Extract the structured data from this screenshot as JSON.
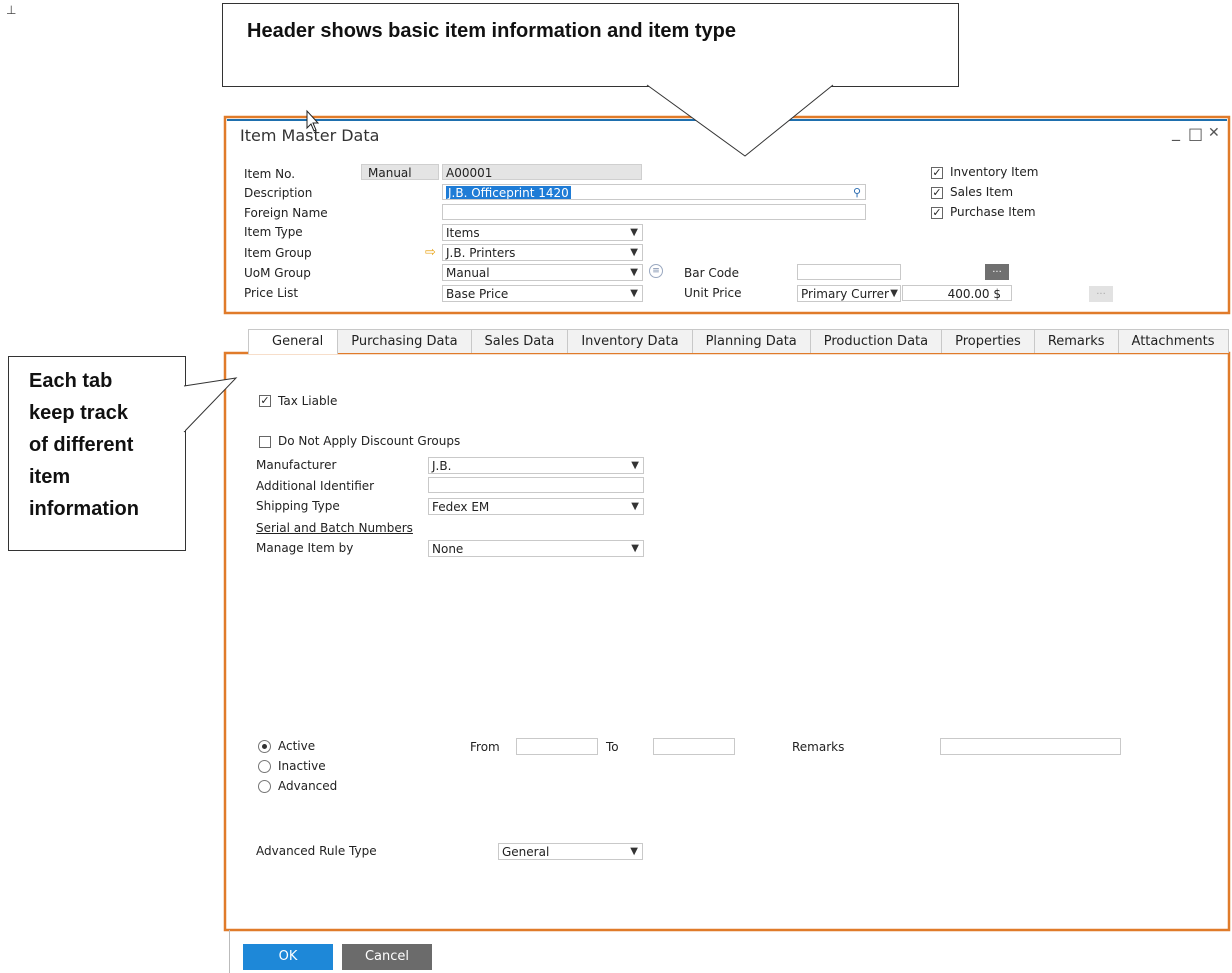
{
  "annotations": {
    "header_callout": "Header shows basic item information and item type",
    "tab_callout_lines": [
      "Each tab",
      "keep track",
      "of different",
      "item",
      "information"
    ]
  },
  "window": {
    "title": "Item Master Data",
    "controls": {
      "minimize": "_",
      "maximize": "□",
      "close": "✕"
    }
  },
  "header": {
    "item_no_label": "Item No.",
    "item_no_series": "Manual",
    "item_no_value": "A00001",
    "description_label": "Description",
    "description_value": "J.B. Officeprint 1420",
    "foreign_name_label": "Foreign Name",
    "foreign_name_value": "",
    "item_type_label": "Item Type",
    "item_type_value": "Items",
    "item_group_label": "Item Group",
    "item_group_value": "J.B. Printers",
    "uom_group_label": "UoM Group",
    "uom_group_value": "Manual",
    "price_list_label": "Price List",
    "price_list_value": "Base Price",
    "bar_code_label": "Bar Code",
    "bar_code_value": "",
    "unit_price_label": "Unit Price",
    "currency_value": "Primary Currer",
    "unit_price_value": "400.00 $",
    "dots_label": "...",
    "checkboxes": {
      "inventory_item": {
        "label": "Inventory Item",
        "checked": true
      },
      "sales_item": {
        "label": "Sales Item",
        "checked": true
      },
      "purchase_item": {
        "label": "Purchase Item",
        "checked": true
      }
    }
  },
  "tabs": [
    {
      "label": "General",
      "active": true
    },
    {
      "label": "Purchasing Data",
      "active": false
    },
    {
      "label": "Sales Data",
      "active": false
    },
    {
      "label": "Inventory Data",
      "active": false
    },
    {
      "label": "Planning Data",
      "active": false
    },
    {
      "label": "Production Data",
      "active": false
    },
    {
      "label": "Properties",
      "active": false
    },
    {
      "label": "Remarks",
      "active": false
    },
    {
      "label": "Attachments",
      "active": false
    }
  ],
  "general": {
    "tax_liable_label": "Tax Liable",
    "tax_liable_checked": true,
    "no_discount_label": "Do Not Apply Discount Groups",
    "no_discount_checked": false,
    "manufacturer_label": "Manufacturer",
    "manufacturer_value": "J.B.",
    "additional_identifier_label": "Additional Identifier",
    "additional_identifier_value": "",
    "shipping_type_label": "Shipping Type",
    "shipping_type_value": "Fedex EM",
    "serial_batch_label": "Serial and Batch Numbers",
    "manage_by_label": "Manage Item by",
    "manage_by_value": "None",
    "status_options": [
      {
        "label": "Active",
        "selected": true
      },
      {
        "label": "Inactive",
        "selected": false
      },
      {
        "label": "Advanced",
        "selected": false
      }
    ],
    "from_label": "From",
    "to_label": "To",
    "remarks_label": "Remarks",
    "advanced_rule_label": "Advanced Rule Type",
    "advanced_rule_value": "General"
  },
  "footer": {
    "ok_label": "OK",
    "cancel_label": "Cancel"
  },
  "colors": {
    "highlight_border": "#e07b2a",
    "ok_button": "#1e88d8",
    "cancel_button": "#6b6b6b",
    "window_top_border": "#1e6fae",
    "selection": "#cfe3f7"
  }
}
